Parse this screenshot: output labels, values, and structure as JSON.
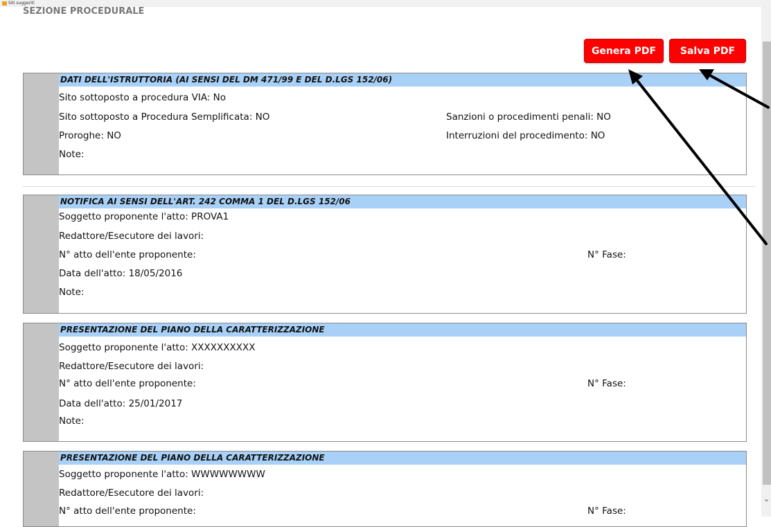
{
  "browser": {
    "bookmarks_label": "Siti suggeriti",
    "bookmarks_icon": "bookmark-folder-icon"
  },
  "page": {
    "section_title": "SEZIONE PROCEDURALE"
  },
  "buttons": {
    "genera_pdf": "Genera PDF",
    "salva_pdf": "Salva PDF",
    "color": "#ff0000"
  },
  "panels": [
    {
      "header": "DATI DELL'ISTRUTTORIA (AI SENSI DEL DM 471/99 E DEL D.LGS 152/06)",
      "rows": [
        "Sito sottoposto a procedura VIA: No",
        "Sito sottoposto a Procedura Semplificata: NO",
        "Proroghe: NO",
        "Note:"
      ],
      "right": [
        "Sanzioni o procedimenti penali: NO",
        "Interruzioni del procedimento: NO"
      ]
    },
    {
      "header": "NOTIFICA AI SENSI DELL'ART. 242 COMMA 1 DEL D.LGS 152/06",
      "rows": [
        "Soggetto proponente l'atto: PROVA1",
        "Redattore/Esecutore dei lavori:",
        "N° atto dell'ente proponente:",
        "Data dell'atto: 18/05/2016",
        "Note:"
      ],
      "right_fase": "N° Fase:"
    },
    {
      "header": "PRESENTAZIONE DEL PIANO DELLA CARATTERIZZAZIONE",
      "rows": [
        "Soggetto proponente l'atto: XXXXXXXXXX",
        "Redattore/Esecutore dei lavori:",
        "N° atto dell'ente proponente:",
        "Data dell'atto: 25/01/2017",
        "Note:"
      ],
      "right_fase": "N° Fase:"
    },
    {
      "header": "PRESENTAZIONE DEL PIANO DELLA CARATTERIZZAZIONE",
      "rows": [
        "Soggetto proponente l'atto: WWWWWWWW",
        "Redattore/Esecutore dei lavori:",
        "N° atto dell'ente proponente:"
      ],
      "right_fase": "N° Fase:"
    }
  ],
  "colors": {
    "header_bg": "#a9d1f7",
    "side_bar": "#c4c4c4",
    "annotation_arrow": "#000000"
  }
}
